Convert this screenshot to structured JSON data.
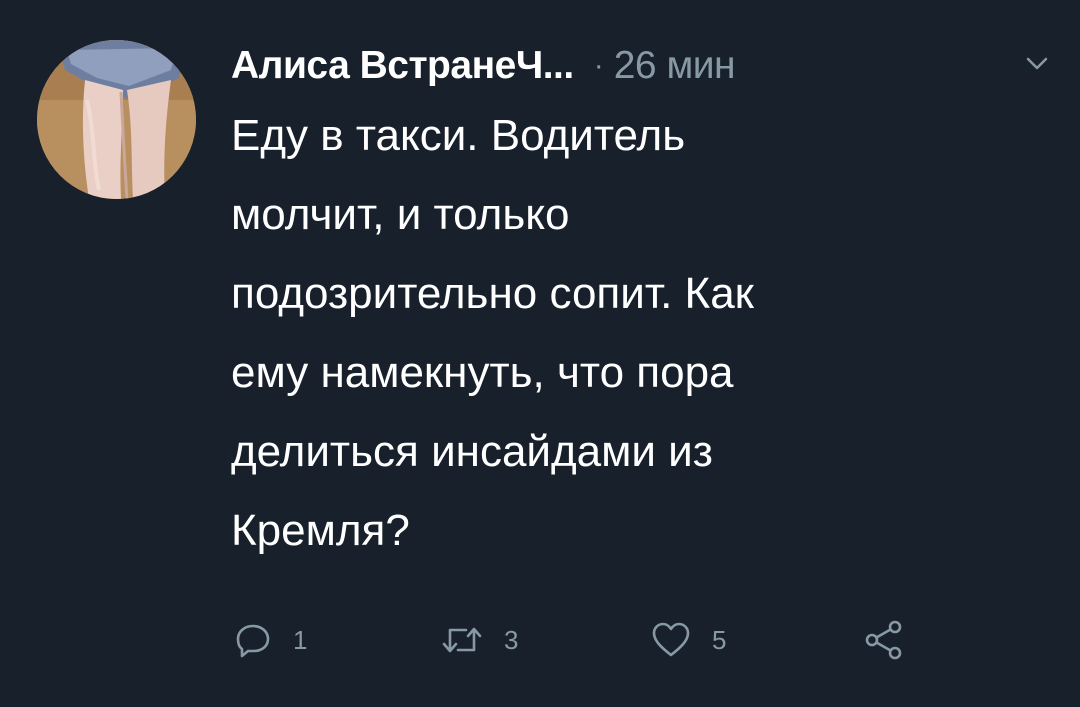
{
  "tweet": {
    "author_name": "Алиса ВстранеЧ...",
    "separator": "·",
    "time": "26 мин",
    "text_lines": [
      "Еду в такси. Водитель",
      "молчит, и только",
      "подозрительно сопит. Как",
      "ему намекнуть, что пора",
      "делиться инсайдами из",
      "Кремля?"
    ],
    "reply_count": "1",
    "retweet_count": "3",
    "like_count": "5",
    "icons": {
      "reply": "reply-icon",
      "retweet": "retweet-icon",
      "like": "heart-icon",
      "share": "share-icon",
      "menu": "chevron-down-icon"
    }
  },
  "colors": {
    "background": "#17202b",
    "primary_text": "#ffffff",
    "secondary_text": "#8899a6"
  }
}
